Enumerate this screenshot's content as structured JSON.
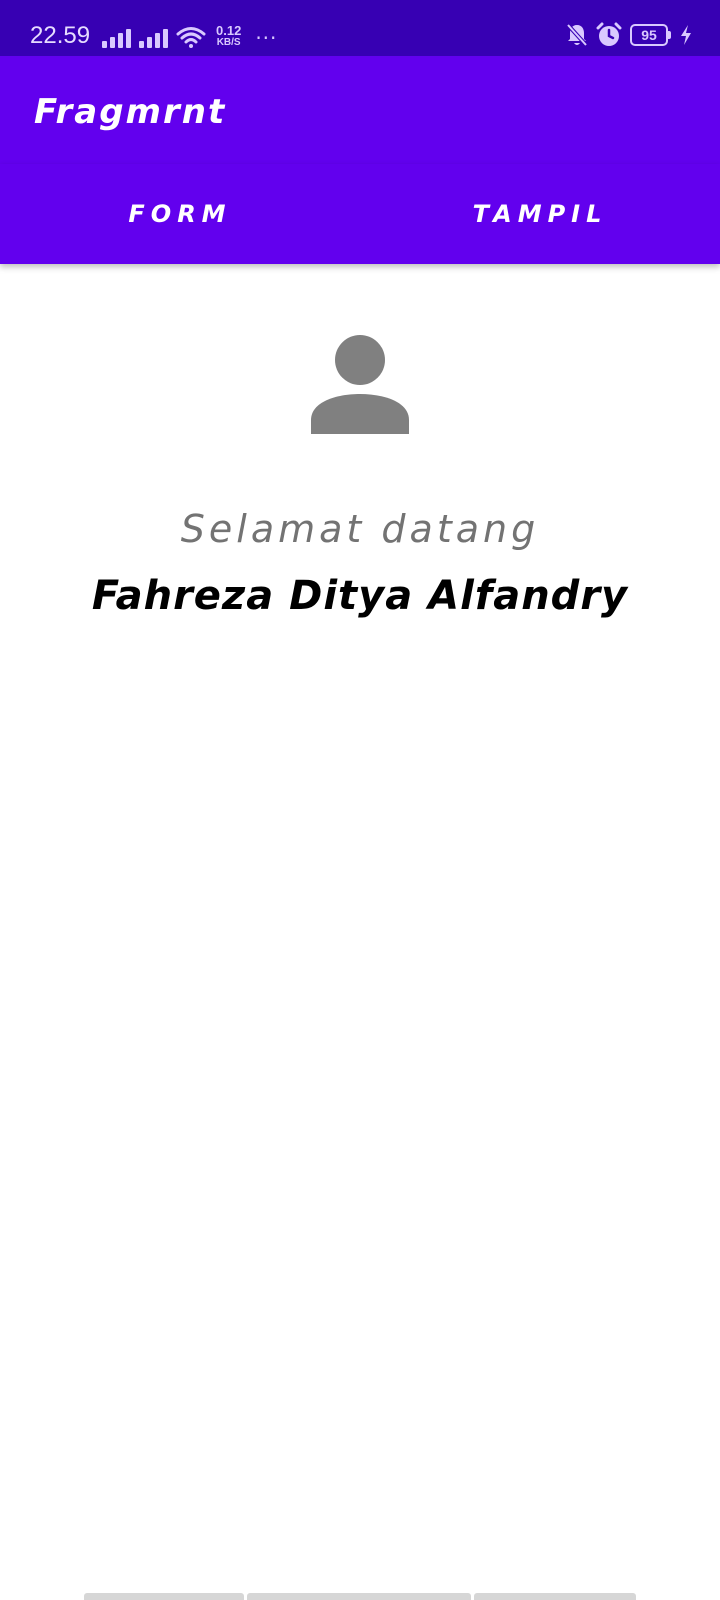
{
  "status_bar": {
    "time": "22.59",
    "net_speed_value": "0.12",
    "net_speed_unit": "KB/S",
    "more": "···",
    "battery": "95",
    "icons": [
      "signal-icon",
      "signal-icon",
      "wifi-icon",
      "bell-off-icon",
      "alarm-icon",
      "battery-icon",
      "charging-icon"
    ]
  },
  "app_bar": {
    "title": "Fragmrnt"
  },
  "tabs": [
    {
      "label": "FORM"
    },
    {
      "label": "TAMPIL"
    }
  ],
  "content": {
    "avatar_icon": "person-icon",
    "welcome": "Selamat datang",
    "name": "Fahreza Ditya Alfandry"
  },
  "colors": {
    "status_bar": "#3700b3",
    "primary": "#6200ee",
    "welcome_text": "#737373",
    "avatar": "#808080"
  }
}
